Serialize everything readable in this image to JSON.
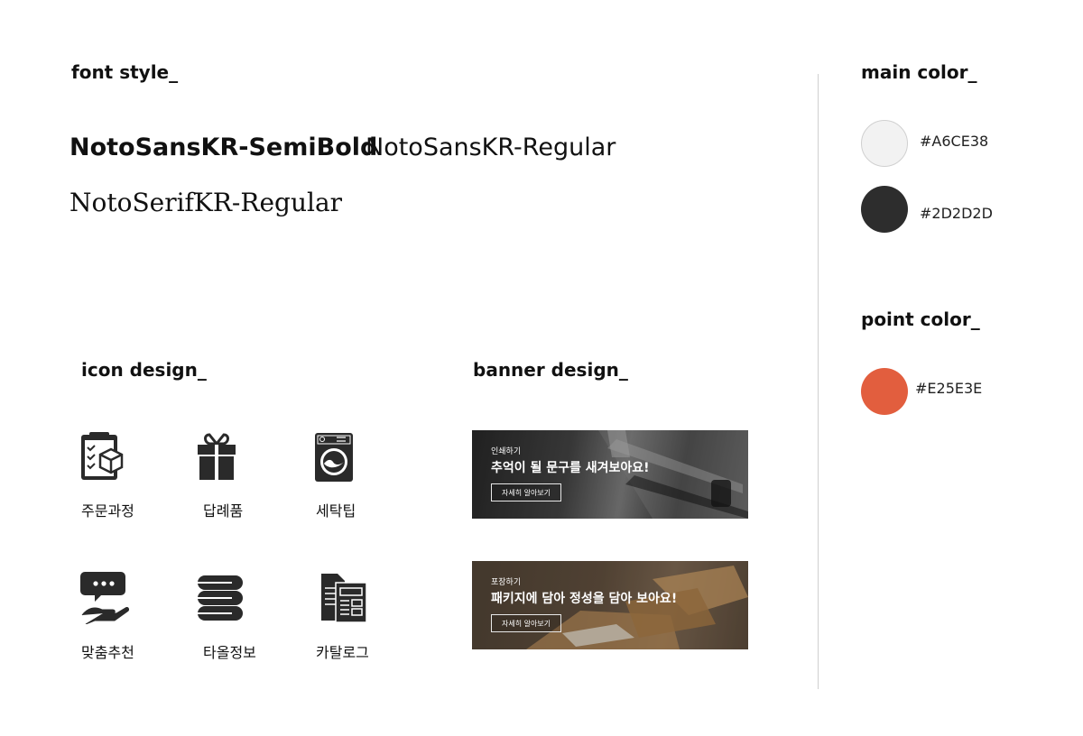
{
  "font_section": {
    "heading": "font style_",
    "samples": [
      "NotoSansKR-SemiBold",
      "NotoSansKR-Regular",
      "NotoSerifKR-Regular"
    ]
  },
  "main_color": {
    "heading": "main color_",
    "swatches": [
      {
        "hex_label": "#A6CE38",
        "fill": "#F2F2F2"
      },
      {
        "hex_label": "#2D2D2D",
        "fill": "#2D2D2D"
      }
    ]
  },
  "point_color": {
    "heading": "point color_",
    "swatches": [
      {
        "hex_label": "#E25E3E",
        "fill": "#E25E3E"
      }
    ]
  },
  "icon_section": {
    "heading": "icon design_",
    "icons": [
      {
        "label": "주문과정",
        "icon": "clipboard-box-icon"
      },
      {
        "label": "답례품",
        "icon": "gift-icon"
      },
      {
        "label": "세탁팁",
        "icon": "washing-machine-icon"
      },
      {
        "label": "맞춤추천",
        "icon": "chat-hand-icon"
      },
      {
        "label": "타올정보",
        "icon": "towel-stack-icon"
      },
      {
        "label": "카탈로그",
        "icon": "catalog-icon"
      }
    ]
  },
  "banner_section": {
    "heading": "banner design_",
    "banners": [
      {
        "category": "인쇄하기",
        "title": "추억이 될 문구를 새겨보아요!",
        "button": "자세히 알아보기"
      },
      {
        "category": "포장하기",
        "title": "패키지에 담아 정성을 담아 보아요!",
        "button": "자세히 알아보기"
      }
    ]
  }
}
